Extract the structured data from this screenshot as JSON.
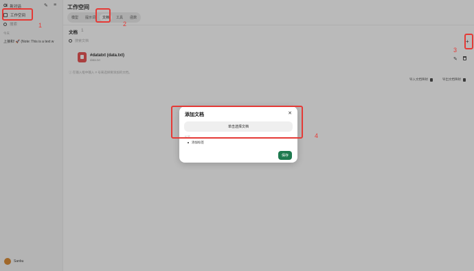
{
  "sidebar": {
    "logo": "OI",
    "new_chat": "新对话",
    "workspace": "工作空间",
    "search_placeholder": "搜索",
    "section_label": "今天",
    "chat_item": "上接和! 🚀 (Note: This is a text w",
    "user_name": "Sanbu"
  },
  "main": {
    "title": "工作空间",
    "tabs": [
      {
        "label": "模型",
        "active": false
      },
      {
        "label": "提示词",
        "active": false
      },
      {
        "label": "文档",
        "active": true
      },
      {
        "label": "工具",
        "active": false
      },
      {
        "label": "函数",
        "active": false
      }
    ],
    "docs_heading": "文档",
    "docs_count": "1",
    "search_placeholder": "搜索文档",
    "doc": {
      "name": "#datatxt (data.txt)",
      "filename": "data.txt"
    },
    "hint": "ⓘ 在输入框中输入 # 号来选择要添加的文档。",
    "import_label": "导入文档映射",
    "export_label": "导出文档映射"
  },
  "modal": {
    "title": "添加文档",
    "select_button": "单击选择文档",
    "tags_label": "标签",
    "add_tag": "添加标签",
    "save": "保存"
  },
  "annotations": [
    "1",
    "2",
    "3",
    "4"
  ],
  "colors": {
    "annotation": "#e53935",
    "save": "#1e7a4f",
    "doc_icon": "#e84a4a"
  }
}
